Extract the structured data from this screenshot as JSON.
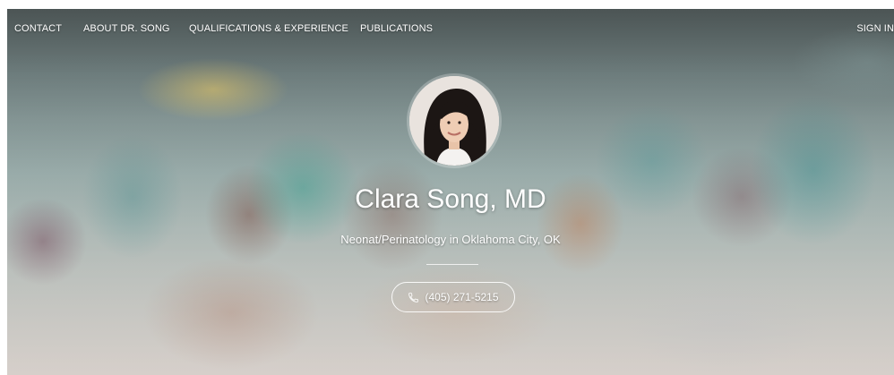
{
  "nav": {
    "items": [
      {
        "label": "CONTACT"
      },
      {
        "label": "ABOUT DR. SONG"
      },
      {
        "label": "QUALIFICATIONS & EXPERIENCE"
      },
      {
        "label": "PUBLICATIONS"
      }
    ],
    "sign_in": "SIGN IN"
  },
  "profile": {
    "name": "Clara Song, MD",
    "specialty": "Neonat/Perinatology in Oklahoma City, OK",
    "phone": "(405) 271-5215",
    "phone_icon": "phone-icon"
  },
  "colors": {
    "text": "#ffffff",
    "hero_teal": "#7f9191"
  }
}
